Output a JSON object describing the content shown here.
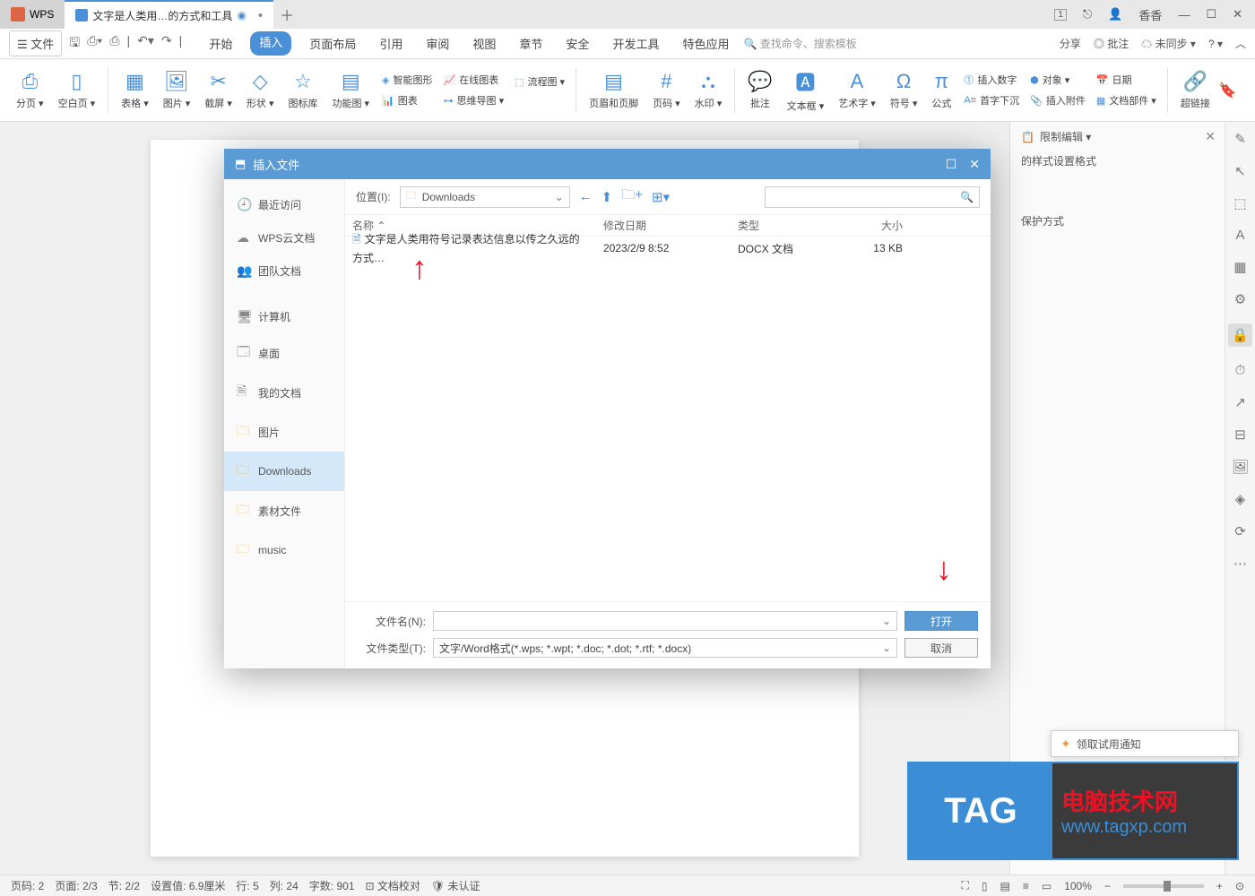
{
  "titlebar": {
    "wps_tab": "WPS",
    "doc_tab": "文字是人类用…的方式和工具",
    "user": "香香"
  },
  "menubar": {
    "file": "文件",
    "tabs": [
      "开始",
      "插入",
      "页面布局",
      "引用",
      "审阅",
      "视图",
      "章节",
      "安全",
      "开发工具",
      "特色应用"
    ],
    "active_tab": "插入",
    "search": "查找命令、搜索模板",
    "share": "分享",
    "annotations": "批注",
    "sync": "未同步"
  },
  "ribbon": {
    "page_break": "分页 ▾",
    "blank_page": "空白页 ▾",
    "table": "表格 ▾",
    "picture": "图片 ▾",
    "screenshot": "截屏 ▾",
    "shapes": "形状 ▾",
    "icon_lib": "图标库",
    "function_chart": "功能图 ▾",
    "smart_art": "智能图形",
    "online_chart": "在线图表",
    "flowchart": "流程图 ▾",
    "chart": "图表",
    "mindmap": "思维导图 ▾",
    "header_footer": "页眉和页脚",
    "page_num": "页码 ▾",
    "watermark": "水印 ▾",
    "comments": "批注",
    "textbox": "文本框 ▾",
    "wordart": "艺术字 ▾",
    "symbol": "符号 ▾",
    "formula": "公式",
    "insert_number": "插入数字",
    "drop_cap": "首字下沉",
    "object": "对象 ▾",
    "attachment": "插入附件",
    "date": "日期",
    "doc_parts": "文档部件 ▾",
    "hyperlink": "超链接"
  },
  "side_panel": {
    "title": "限制编辑 ▾",
    "line1": "的样式设置格式",
    "line2": "保护方式"
  },
  "dialog": {
    "title": "插入文件",
    "sidebar": [
      {
        "icon": "clock",
        "label": "最近访问"
      },
      {
        "icon": "cloud",
        "label": "WPS云文档"
      },
      {
        "icon": "team",
        "label": "团队文档"
      },
      {
        "icon": "computer",
        "label": "计算机"
      },
      {
        "icon": "desktop",
        "label": "桌面"
      },
      {
        "icon": "docs",
        "label": "我的文档"
      },
      {
        "icon": "folder",
        "label": "图片"
      },
      {
        "icon": "folder",
        "label": "Downloads",
        "active": true
      },
      {
        "icon": "folder",
        "label": "素材文件"
      },
      {
        "icon": "folder",
        "label": "music"
      }
    ],
    "location_label": "位置(I):",
    "location_value": "Downloads",
    "columns": [
      "名称",
      "修改日期",
      "类型",
      "大小"
    ],
    "row": {
      "name": "文字是人类用符号记录表达信息以传之久远的方式…",
      "date": "2023/2/9 8:52",
      "type": "DOCX 文档",
      "size": "13 KB"
    },
    "filename_label": "文件名(N):",
    "filename_value": "",
    "filetype_label": "文件类型(T):",
    "filetype_value": "文字/Word格式(*.wps; *.wpt; *.doc; *.dot; *.rtf; *.docx)",
    "open_btn": "打开",
    "cancel_btn": "取消"
  },
  "statusbar": {
    "page_num": "页码: 2",
    "page": "页面: 2/3",
    "section": "节: 2/2",
    "position": "设置值: 6.9厘米",
    "row": "行: 5",
    "col": "列: 24",
    "word_count": "字数: 901",
    "doc_proof": "文档校对",
    "not_verified": "未认证",
    "zoom": "100%"
  },
  "trial_popup": "领取试用通知",
  "tag_banner": {
    "logo": "TAG",
    "line1": "电脑技术网",
    "line2": "www.tagxp.com"
  }
}
